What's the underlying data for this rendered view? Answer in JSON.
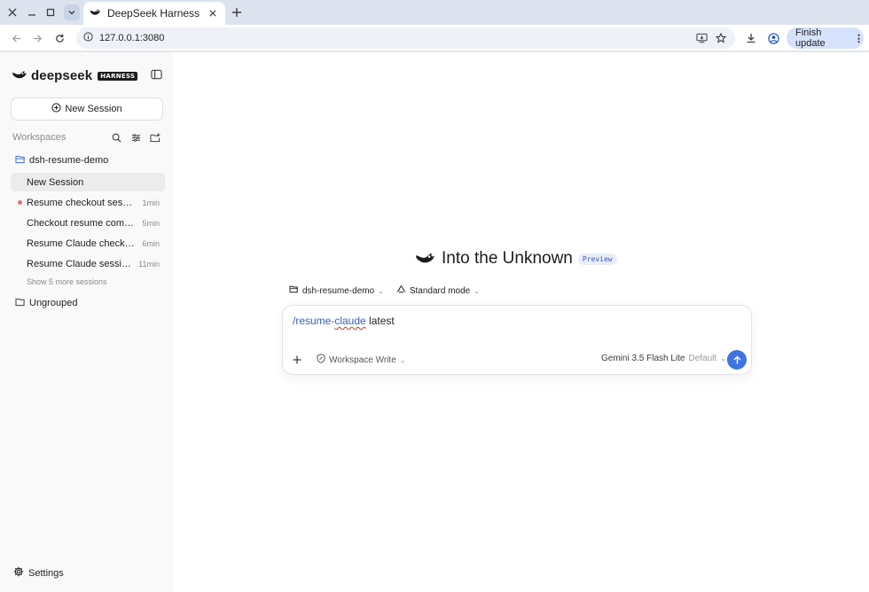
{
  "browser": {
    "tab_title": "DeepSeek Harness",
    "url": "127.0.0.1:3080",
    "finish_update_label": "Finish update"
  },
  "sidebar": {
    "brand_name": "deepseek",
    "brand_badge": "HARNESS",
    "new_session_label": "New Session",
    "workspaces_label": "Workspaces",
    "workspace_name": "dsh-resume-demo",
    "sessions": [
      {
        "title": "New Session",
        "time": "",
        "active": true,
        "unread": false
      },
      {
        "title": "Resume checkout session",
        "time": "1min",
        "active": false,
        "unread": true
      },
      {
        "title": "Checkout resume comma…",
        "time": "5min",
        "active": false,
        "unread": false
      },
      {
        "title": "Resume Claude checkout …",
        "time": "6min",
        "active": false,
        "unread": false
      },
      {
        "title": "Resume Claude session c…",
        "time": "11min",
        "active": false,
        "unread": false
      }
    ],
    "show_more_label": "Show 5 more sessions",
    "ungrouped_label": "Ungrouped",
    "settings_label": "Settings"
  },
  "main": {
    "hero_title": "Into the Unknown",
    "preview_badge": "Preview",
    "workspace_selector": "dsh-resume-demo",
    "mode_selector": "Standard mode",
    "composer": {
      "command": "/resume-",
      "command_squiggle": "claude",
      "argument": " latest",
      "permission_label": "Workspace Write",
      "model_name": "Gemini 3.5 Flash Lite",
      "model_default": "Default"
    }
  },
  "colors": {
    "accent": "#3f73e0",
    "command_text": "#3461c9",
    "unread_dot": "#e8707a"
  }
}
